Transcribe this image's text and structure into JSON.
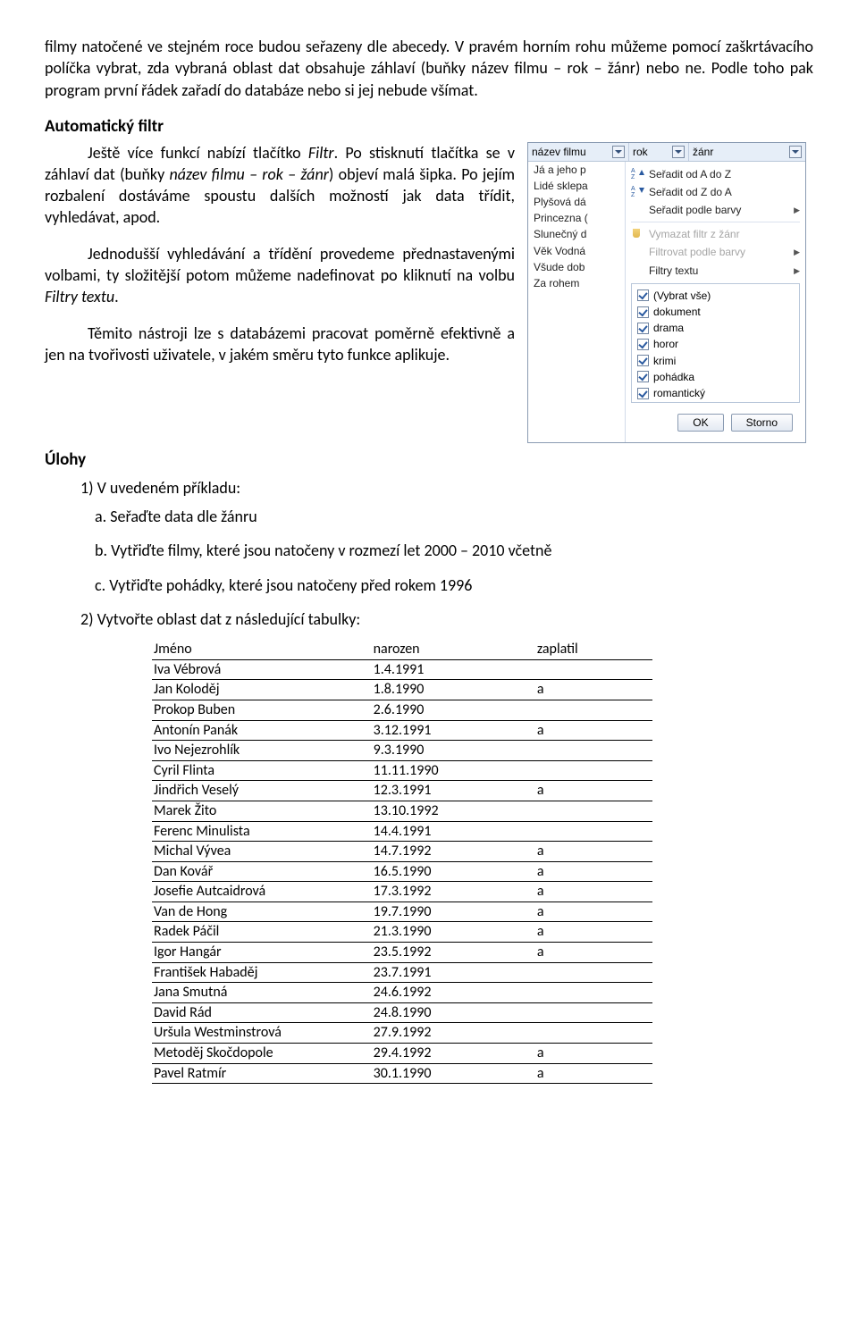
{
  "intro_paragraph": "filmy natočené ve stejném roce budou seřazeny dle abecedy. V pravém horním rohu můžeme pomocí zaškrtávacího políčka vybrat, zda vybraná oblast dat obsahuje záhlaví (buňky název filmu – rok – žánr) nebo ne. Podle toho pak program první řádek zařadí do databáze nebo si jej nebude všímat.",
  "sect_autofilter_heading": "Automatický filtr",
  "p_autofilter_1a": "Ještě více funkcí nabízí tlačítko ",
  "p_autofilter_1b": "Filtr",
  "p_autofilter_1c": ". Po stisknutí tlačítka se v záhlaví dat (buňky ",
  "p_autofilter_1d": "název filmu – rok – žánr",
  "p_autofilter_1e": ") objeví malá šipka. Po jejím rozbalení dostáváme spoustu dalších možností jak data třídit, vyhledávat, apod.",
  "p_autofilter_2a": "Jednodušší vyhledávání a třídění provedeme přednastavenými volbami, ty složitější potom můžeme nadefinovat po kliknutí na volbu ",
  "p_autofilter_2b": "Filtry textu",
  "p_autofilter_2c": ".",
  "p_autofilter_3": "Těmito nástroji lze s databázemi pracovat poměrně efektivně a jen na tvořivosti uživatele, v jakém směru tyto funkce aplikuje.",
  "filter": {
    "col_a": "název filmu",
    "col_b": "rok",
    "col_c": "žánr",
    "names": [
      "Já a jeho p",
      "Lidé sklepa",
      "Plyšová dá",
      "Princezna (",
      "Slunečný d",
      "Věk Vodná",
      "Všude dob",
      "Za rohem"
    ],
    "menu_sort_asc": "Seřadit od A do Z",
    "menu_sort_desc": "Seřadit od Z do A",
    "menu_sort_color": "Seřadit podle barvy",
    "menu_clear": "Vymazat filtr z žánr",
    "menu_bycolor": "Filtrovat podle barvy",
    "menu_text": "Filtry textu",
    "cb_all": "(Vybrat vše)",
    "cb": [
      "dokument",
      "drama",
      "horor",
      "krimi",
      "pohádka",
      "romantický"
    ],
    "ok": "OK",
    "cancel": "Storno"
  },
  "tasks_heading": "Úlohy",
  "task1": "1) V uvedeném příkladu:",
  "task1a": "a. Seřaďte data dle žánru",
  "task1b": "b. Vytřiďte filmy, které jsou natočeny v rozmezí let 2000 – 2010 včetně",
  "task1c": "c. Vytřiďte pohádky, které jsou natočeny před rokem 1996",
  "task2": "2) Vytvořte oblast dat z následující tabulky:",
  "table": {
    "h1": "Jméno",
    "h2": "narozen",
    "h3": "zaplatil",
    "rows": [
      [
        "Iva Vébrová",
        "1.4.1991",
        ""
      ],
      [
        "Jan Koloděj",
        "1.8.1990",
        "a"
      ],
      [
        "Prokop Buben",
        "2.6.1990",
        ""
      ],
      [
        "Antonín Panák",
        "3.12.1991",
        "a"
      ],
      [
        "Ivo Nejezrohlík",
        "9.3.1990",
        ""
      ],
      [
        "Cyril Flinta",
        "11.11.1990",
        ""
      ],
      [
        "Jindřich Veselý",
        "12.3.1991",
        "a"
      ],
      [
        "Marek Žito",
        "13.10.1992",
        ""
      ],
      [
        "Ferenc Minulista",
        "14.4.1991",
        ""
      ],
      [
        "Michal Vývea",
        "14.7.1992",
        "a"
      ],
      [
        "Dan Kovář",
        "16.5.1990",
        "a"
      ],
      [
        "Josefie Autcaidrová",
        "17.3.1992",
        "a"
      ],
      [
        "Van de Hong",
        "19.7.1990",
        "a"
      ],
      [
        "Radek Páčil",
        "21.3.1990",
        "a"
      ],
      [
        "Igor Hangár",
        "23.5.1992",
        "a"
      ],
      [
        "František Habaděj",
        "23.7.1991",
        ""
      ],
      [
        "Jana Smutná",
        "24.6.1992",
        ""
      ],
      [
        "David Rád",
        "24.8.1990",
        ""
      ],
      [
        "Uršula Westminstrová",
        "27.9.1992",
        ""
      ],
      [
        "Metoděj Skočdopole",
        "29.4.1992",
        "a"
      ],
      [
        "Pavel Ratmír",
        "30.1.1990",
        "a"
      ]
    ]
  }
}
